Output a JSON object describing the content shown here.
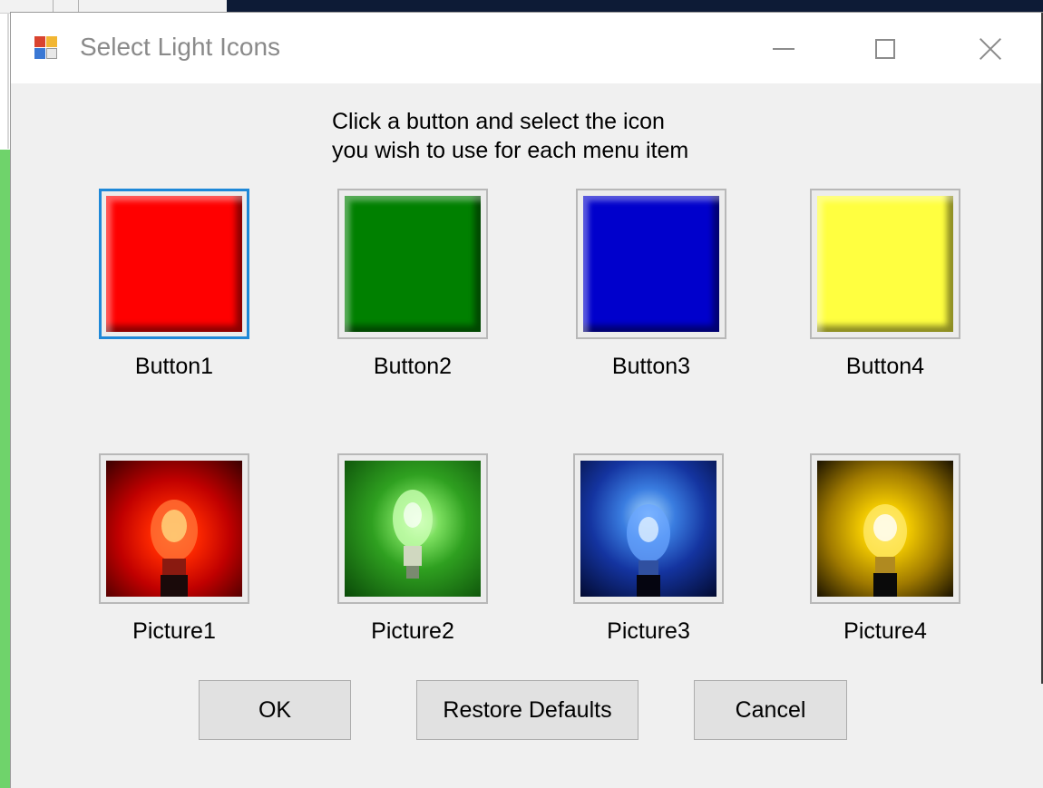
{
  "window": {
    "title": "Select Light Icons",
    "instructions_line1": "Click a button and select the icon",
    "instructions_line2": "you wish to use for each menu item"
  },
  "buttons": [
    {
      "label": "Button1",
      "color": "#ff0000",
      "selected": true
    },
    {
      "label": "Button2",
      "color": "#008000",
      "selected": false
    },
    {
      "label": "Button3",
      "color": "#0000cc",
      "selected": false
    },
    {
      "label": "Button4",
      "color": "#ffff40",
      "selected": false
    }
  ],
  "pictures": [
    {
      "label": "Picture1",
      "icon": "red-light-bulb-icon",
      "color": "#e01010"
    },
    {
      "label": "Picture2",
      "icon": "green-light-bulb-icon",
      "color": "#30b020"
    },
    {
      "label": "Picture3",
      "icon": "blue-light-bulb-icon",
      "color": "#2050d0"
    },
    {
      "label": "Picture4",
      "icon": "yellow-light-bulb-icon",
      "color": "#e0c000"
    }
  ],
  "actions": {
    "ok_label": "OK",
    "restore_label": "Restore Defaults",
    "cancel_label": "Cancel"
  }
}
